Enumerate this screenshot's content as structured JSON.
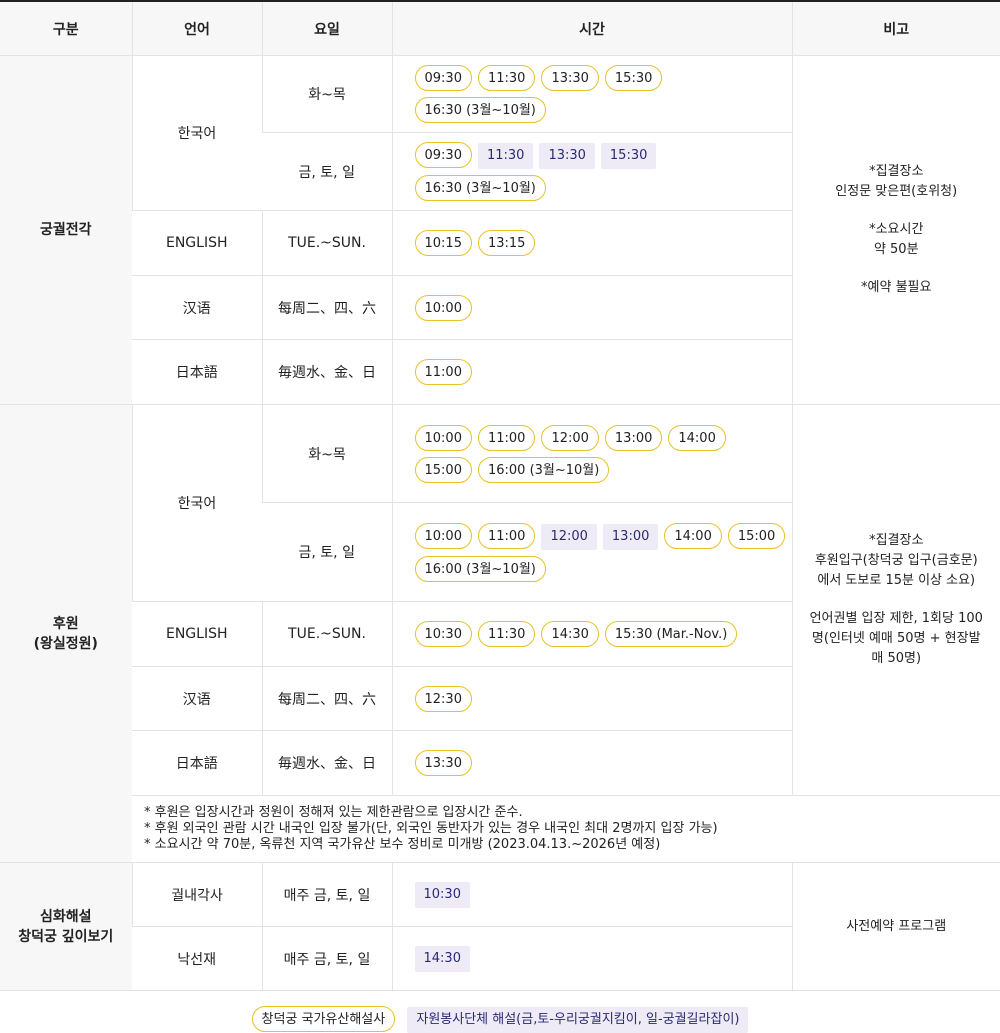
{
  "headers": {
    "category": "구분",
    "language": "언어",
    "day": "요일",
    "time": "시간",
    "remark": "비고"
  },
  "s1": {
    "category": "궁궐전각",
    "remark": [
      "*집결장소",
      "인정문 맞은편(호위청)",
      "*소요시간",
      "약 50분",
      "*예약 불필요"
    ],
    "rows": [
      {
        "lang": "한국어",
        "day": "화~목",
        "times": [
          {
            "t": "09:30",
            "k": "p"
          },
          {
            "t": "11:30",
            "k": "p"
          },
          {
            "t": "13:30",
            "k": "p"
          },
          {
            "t": "15:30",
            "k": "p"
          },
          {
            "t": "16:30 (3월~10월)",
            "k": "p"
          }
        ]
      },
      {
        "lang": "한국어",
        "day": "금, 토, 일",
        "times": [
          {
            "t": "09:30",
            "k": "p"
          },
          {
            "t": "11:30",
            "k": "v"
          },
          {
            "t": "13:30",
            "k": "v"
          },
          {
            "t": "15:30",
            "k": "v"
          },
          {
            "t": "16:30 (3월~10월)",
            "k": "p"
          }
        ]
      },
      {
        "lang": "ENGLISH",
        "day": "TUE.~SUN.",
        "times": [
          {
            "t": "10:15",
            "k": "p"
          },
          {
            "t": "13:15",
            "k": "p"
          }
        ]
      },
      {
        "lang": "汉语",
        "day": "每周二、四、六",
        "times": [
          {
            "t": "10:00",
            "k": "p"
          }
        ]
      },
      {
        "lang": "日本語",
        "day": "毎週水、金、日",
        "times": [
          {
            "t": "11:00",
            "k": "p"
          }
        ]
      }
    ]
  },
  "s2": {
    "category": "후원",
    "category2": "(왕실정원)",
    "remark": [
      "*집결장소",
      "후원입구(창덕궁 입구(금호문)",
      "에서 도보로 15분 이상 소요)",
      "언어권별 입장 제한, 1회당 100",
      "명(인터넷 예매 50명 + 현장발",
      "매 50명)"
    ],
    "rows": [
      {
        "lang": "한국어",
        "day": "화~목",
        "times": [
          {
            "t": "10:00",
            "k": "p"
          },
          {
            "t": "11:00",
            "k": "p"
          },
          {
            "t": "12:00",
            "k": "p"
          },
          {
            "t": "13:00",
            "k": "p"
          },
          {
            "t": "14:00",
            "k": "p"
          },
          {
            "t": "15:00",
            "k": "p"
          },
          {
            "t": "16:00 (3월~10월)",
            "k": "p"
          }
        ]
      },
      {
        "lang": "한국어",
        "day": "금, 토, 일",
        "times": [
          {
            "t": "10:00",
            "k": "p"
          },
          {
            "t": "11:00",
            "k": "p"
          },
          {
            "t": "12:00",
            "k": "v"
          },
          {
            "t": "13:00",
            "k": "v"
          },
          {
            "t": "14:00",
            "k": "p"
          },
          {
            "t": "15:00",
            "k": "p"
          },
          {
            "t": "16:00 (3월~10월)",
            "k": "p"
          }
        ]
      },
      {
        "lang": "ENGLISH",
        "day": "TUE.~SUN.",
        "times": [
          {
            "t": "10:30",
            "k": "p"
          },
          {
            "t": "11:30",
            "k": "p"
          },
          {
            "t": "14:30",
            "k": "p"
          },
          {
            "t": "15:30 (Mar.-Nov.)",
            "k": "p"
          }
        ]
      },
      {
        "lang": "汉语",
        "day": "每周二、四、六",
        "times": [
          {
            "t": "12:30",
            "k": "p"
          }
        ]
      },
      {
        "lang": "日本語",
        "day": "毎週水、金、日",
        "times": [
          {
            "t": "13:30",
            "k": "p"
          }
        ]
      }
    ],
    "notices": [
      "* 후원은 입장시간과 정원이 정해져 있는 제한관람으로 입장시간 준수.",
      "* 후원 외국인 관람 시간 내국인 입장 불가(단, 외국인 동반자가 있는 경우 내국인 최대 2명까지 입장 가능)",
      "* 소요시간 약 70분, 옥류천 지역 국가유산 보수 정비로 미개방 (2023.04.13.~2026년 예정)"
    ]
  },
  "s3": {
    "category": "심화해설",
    "category2": "창덕궁 깊이보기",
    "remark": "사전예약 프로그램",
    "rows": [
      {
        "lang": "궐내각사",
        "day": "매주 금, 토, 일",
        "times": [
          {
            "t": "10:30",
            "k": "v"
          }
        ]
      },
      {
        "lang": "낙선재",
        "day": "매주 금, 토, 일",
        "times": [
          {
            "t": "14:30",
            "k": "v"
          }
        ]
      }
    ]
  },
  "legend": {
    "official": "창덕궁 국가유산해설사",
    "volunteer": "자원봉사단체 해설(금,토-우리궁궐지킴이, 일-궁궐길라잡이)"
  }
}
